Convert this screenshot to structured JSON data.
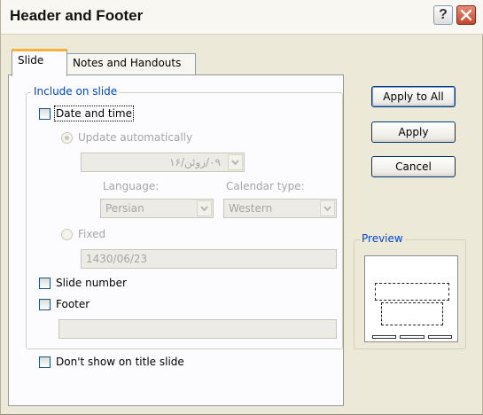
{
  "window": {
    "title": "Header and Footer"
  },
  "tabs": [
    {
      "label": "Slide"
    },
    {
      "label": "Notes and Handouts"
    }
  ],
  "include_group": {
    "label": "Include on slide",
    "date_time": {
      "label": "Date and time",
      "checked": false,
      "update_auto_label": "Update automatically",
      "date_value": "۰۹/زوئن/۱۶",
      "language_label": "Language:",
      "language_value": "Persian",
      "calendar_label": "Calendar type:",
      "calendar_value": "Western",
      "fixed_label": "Fixed",
      "fixed_value": "1430/06/23"
    },
    "slide_number": {
      "label": "Slide number",
      "checked": false
    },
    "footer": {
      "label": "Footer",
      "checked": false,
      "value": ""
    }
  },
  "dont_show_title": {
    "label": "Don't show on title slide",
    "checked": false
  },
  "buttons": {
    "apply_all": "Apply to All",
    "apply": "Apply",
    "cancel": "Cancel"
  },
  "preview": {
    "label": "Preview"
  }
}
